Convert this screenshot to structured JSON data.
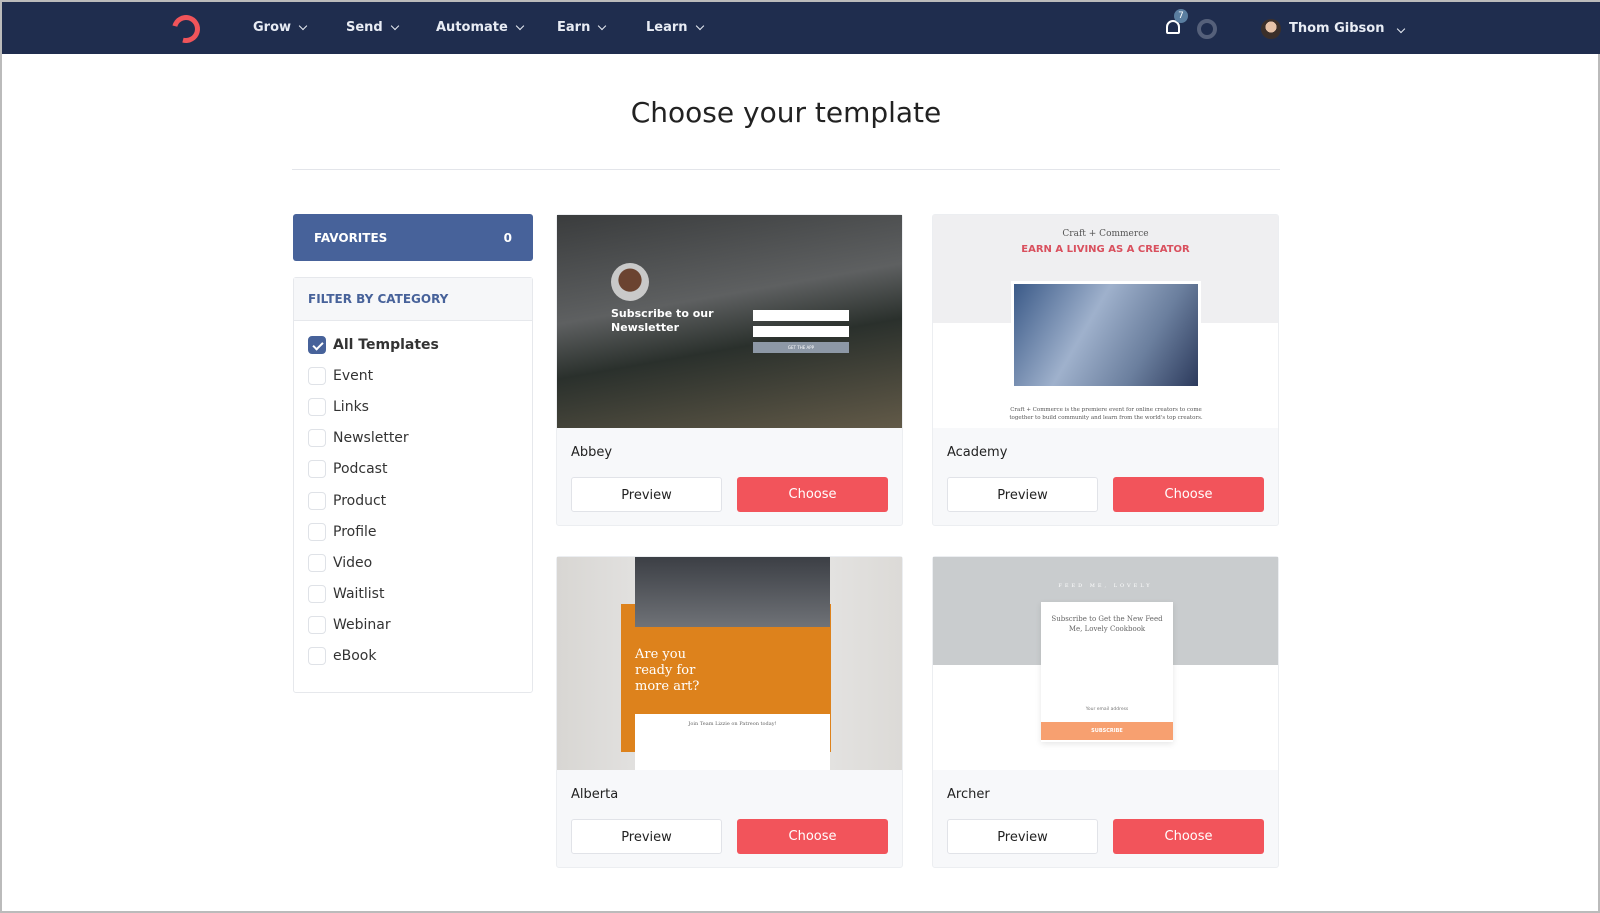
{
  "nav": {
    "menus": [
      "Grow",
      "Send",
      "Automate",
      "Earn",
      "Learn"
    ],
    "notifications": "7",
    "user": "Thom Gibson"
  },
  "page": {
    "title": "Choose your template"
  },
  "favorites": {
    "label": "FAVORITES",
    "count": "0"
  },
  "filter": {
    "title": "FILTER BY CATEGORY",
    "options": [
      {
        "label": "All Templates",
        "checked": true
      },
      {
        "label": "Event"
      },
      {
        "label": "Links"
      },
      {
        "label": "Newsletter"
      },
      {
        "label": "Podcast"
      },
      {
        "label": "Product"
      },
      {
        "label": "Profile"
      },
      {
        "label": "Video"
      },
      {
        "label": "Waitlist"
      },
      {
        "label": "Webinar"
      },
      {
        "label": "eBook"
      }
    ]
  },
  "buttons": {
    "preview": "Preview",
    "choose": "Choose"
  },
  "templates": [
    {
      "name": "Abbey",
      "heading": "Subscribe to our Newsletter",
      "cta": "GET THE APP"
    },
    {
      "name": "Academy",
      "brand": "Craft + Commerce",
      "heading": "EARN A LIVING AS A CREATOR",
      "body": "Craft + Commerce is the premiere event for online creators to come together to build community and learn from the world's top creators."
    },
    {
      "name": "Alberta",
      "heading": "Are you ready for more art?",
      "sub": "Join Team Lizzie on Patreon today!"
    },
    {
      "name": "Archer",
      "brand": "FEED ME, LOVELY",
      "heading": "Subscribe to Get the New Feed Me, Lovely Cookbook",
      "email": "Your email address",
      "cta": "SUBSCRIBE"
    }
  ],
  "colors": {
    "nav": "#1f2d4e",
    "accent": "#47629a",
    "choose": "#f2545b"
  }
}
